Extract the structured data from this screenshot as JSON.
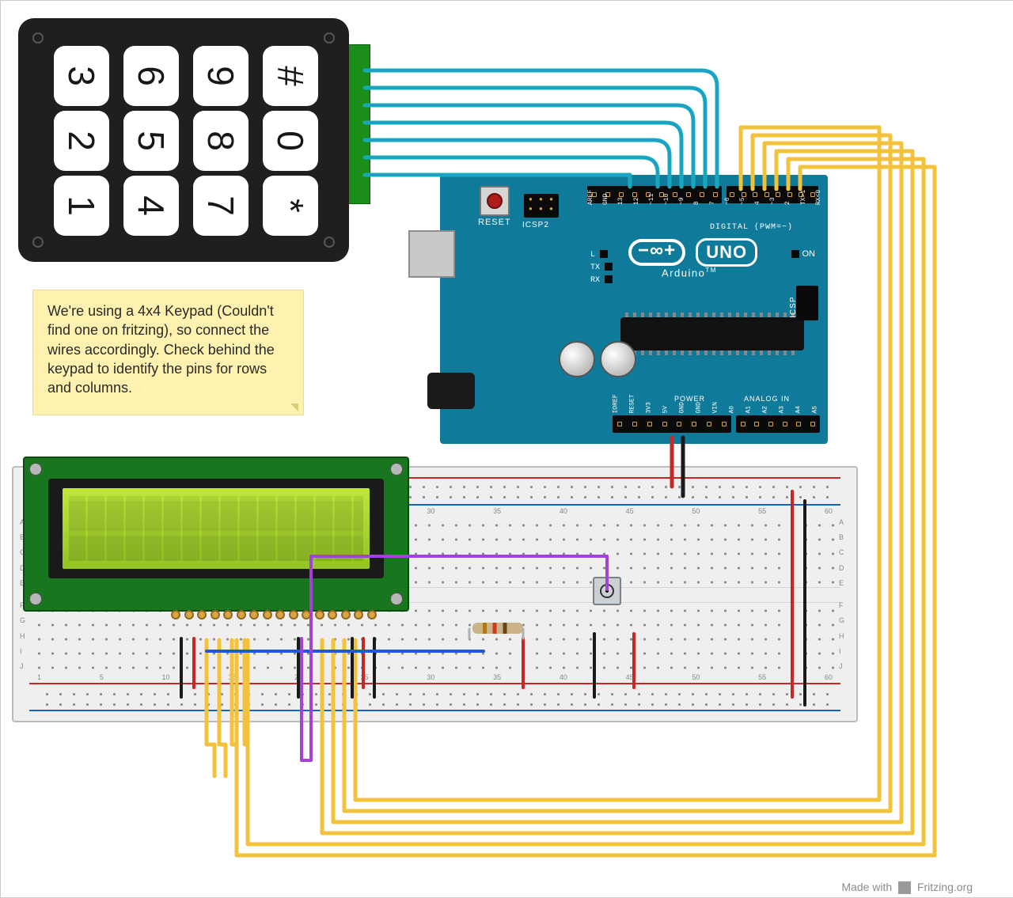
{
  "keypad": {
    "keys": [
      "3",
      "6",
      "9",
      "#",
      "2",
      "5",
      "8",
      "0",
      "1",
      "4",
      "7",
      "*"
    ]
  },
  "note": {
    "text": "We're using a 4x4 Keypad (Couldn't find one on fritzing), so connect the wires accordingly. Check behind the keypad to identify the pins for rows and columns."
  },
  "arduino": {
    "reset_label": "RESET",
    "icsp2_label": "ICSP2",
    "icsp_label": "ICSP",
    "brand": "Arduino",
    "tm": "TM",
    "model": "UNO",
    "digital_label": "DIGITAL (PWM=~)",
    "power_label": "POWER",
    "analog_label": "ANALOG IN",
    "on_label": "ON",
    "led_l": "L",
    "led_tx": "TX",
    "led_rx": "RX",
    "pins_top": [
      "AREF",
      "GND",
      "13",
      "12",
      "~11",
      "~10",
      "~9",
      "8",
      "7",
      "~6",
      "~5",
      "4",
      "~3",
      "2",
      "TX>1",
      "RX<0"
    ],
    "pins_bot": [
      "IOREF",
      "RESET",
      "3V3",
      "5V",
      "GND",
      "GND",
      "VIN",
      "A0",
      "A1",
      "A2",
      "A3",
      "A4",
      "A5"
    ]
  },
  "breadboard": {
    "columns": [
      "1",
      "5",
      "10",
      "15",
      "20",
      "25",
      "30",
      "35",
      "40",
      "45",
      "50",
      "55",
      "60"
    ],
    "rows_top": [
      "A",
      "B",
      "C",
      "D",
      "E"
    ],
    "rows_bot": [
      "F",
      "G",
      "H",
      "I",
      "J"
    ]
  },
  "lcd": {
    "type": "16x2 LCD"
  },
  "components": {
    "resistor": "220Ω resistor",
    "pot": "trimpot"
  },
  "footer": {
    "text1": "Made with",
    "text2": "Fritzing.org"
  },
  "wiring": {
    "keypad_to_arduino": [
      {
        "from": "Keypad pin 1",
        "to": "Arduino D13",
        "color": "teal"
      },
      {
        "from": "Keypad pin 2",
        "to": "Arduino D12",
        "color": "teal"
      },
      {
        "from": "Keypad pin 3",
        "to": "Arduino D11",
        "color": "teal"
      },
      {
        "from": "Keypad pin 4",
        "to": "Arduino D10",
        "color": "teal"
      },
      {
        "from": "Keypad pin 5",
        "to": "Arduino D9",
        "color": "teal"
      },
      {
        "from": "Keypad pin 6",
        "to": "Arduino D8",
        "color": "teal"
      },
      {
        "from": "Keypad pin 7",
        "to": "Arduino D7",
        "color": "teal"
      }
    ],
    "lcd_to_arduino_data": [
      {
        "lcd": "RS",
        "arduino": "D6",
        "color": "yellow"
      },
      {
        "lcd": "EN",
        "arduino": "D5",
        "color": "yellow"
      },
      {
        "lcd": "D4",
        "arduino": "D4",
        "color": "yellow"
      },
      {
        "lcd": "D5",
        "arduino": "D3",
        "color": "yellow"
      },
      {
        "lcd": "D6",
        "arduino": "D2",
        "color": "yellow"
      },
      {
        "lcd": "D7",
        "arduino": "D1/D0",
        "color": "yellow"
      }
    ],
    "power": [
      {
        "desc": "Arduino 5V to breadboard + rail",
        "color": "red"
      },
      {
        "desc": "Arduino GND to breadboard - rail",
        "color": "black"
      },
      {
        "desc": "LCD VSS/RW/K to GND rail",
        "color": "black"
      },
      {
        "desc": "LCD VDD/A(via resistor) to +5V rail",
        "color": "red"
      },
      {
        "desc": "Trimpot wiper to LCD V0",
        "color": "purple"
      }
    ]
  }
}
